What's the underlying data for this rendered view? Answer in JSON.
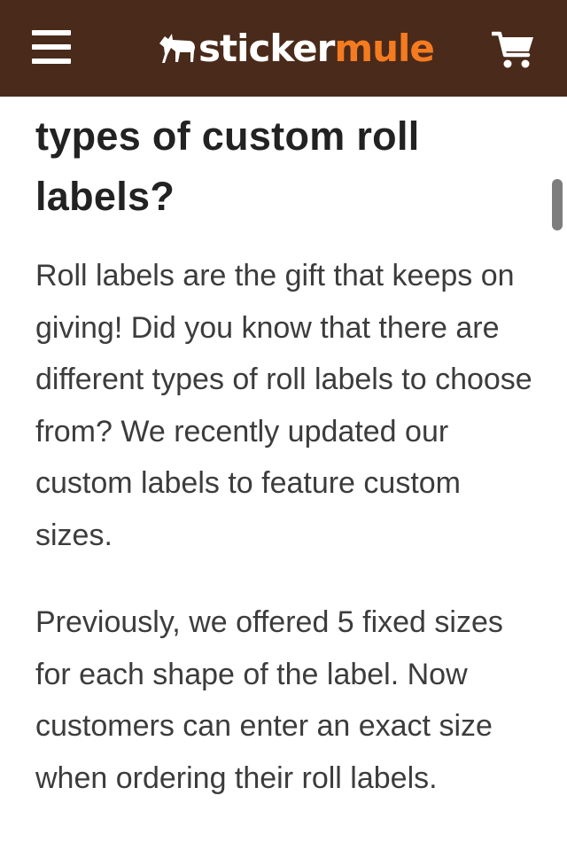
{
  "header": {
    "logo": {
      "word1": "sticker",
      "word2": "mule"
    },
    "colors": {
      "background": "#4a2a1a",
      "accent": "#f47b20"
    }
  },
  "article": {
    "heading": "types of custom roll labels?",
    "paragraphs": [
      "Roll labels are the gift that keeps on giving! Did you know that there are different types of roll labels to choose from? We recently updated our custom labels to feature custom sizes.",
      "Previously, we offered 5 fixed sizes for each shape of the label. Now customers can enter an exact size when ordering their roll labels."
    ]
  },
  "icons": {
    "menu": "hamburger-menu-icon",
    "logo": "mule-logo-icon",
    "cart": "shopping-cart-icon"
  }
}
